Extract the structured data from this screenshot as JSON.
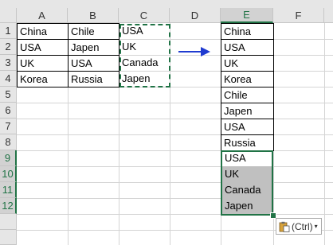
{
  "columns": [
    "A",
    "B",
    "C",
    "D",
    "E",
    "F"
  ],
  "rows": [
    "1",
    "2",
    "3",
    "4",
    "5",
    "6",
    "7",
    "8",
    "9",
    "10",
    "11",
    "12"
  ],
  "column_a": [
    "China",
    "USA",
    "UK",
    "Korea"
  ],
  "column_b": [
    "Chile",
    "Japen",
    "USA",
    "Russia"
  ],
  "column_c": [
    "USA",
    "UK",
    "Canada",
    "Japen"
  ],
  "column_e": [
    "China",
    "USA",
    "UK",
    "Korea",
    "Chile",
    "Japen",
    "USA",
    "Russia",
    "USA",
    "UK",
    "Canada",
    "Japen"
  ],
  "paste_options": {
    "label": "(Ctrl)",
    "icon": "clipboard-icon",
    "caret": "▾"
  },
  "colors": {
    "accent": "#217346",
    "arrow": "#1f3bd0",
    "selection_shade": "#c0c0c0"
  }
}
